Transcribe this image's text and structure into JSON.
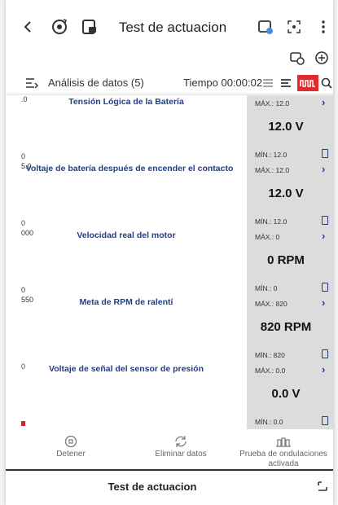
{
  "header": {
    "title": "Test de actuacion",
    "icons": [
      "back-icon",
      "gear-refresh-icon",
      "vehicle-doc-icon",
      "print-icon",
      "screen-capture-icon",
      "more-icon"
    ]
  },
  "subbar": {
    "icons": [
      "car-clock-icon",
      "battery-plug-icon"
    ]
  },
  "toolbar": {
    "label": "Análisis de datos (5)",
    "time": "Tiempo 00:00:02"
  },
  "items": [
    {
      "title": "Tensión Lógica de la Batería",
      "ymax": ".0",
      "ymin": "0",
      "max": "MÁX.: 12.0",
      "min": "MÍN.: 12.0",
      "value": "12.0 V"
    },
    {
      "title": "Voltaje de batería después de encender el contacto",
      "ymax": "5.0",
      "ymin": "0",
      "max": "MÁX.: 12.0",
      "min": "MÍN.: 12.0",
      "value": "12.0 V"
    },
    {
      "title": "Velocidad real del motor",
      "ymax": "000",
      "ymin": "0",
      "max": "MÁX.: 0",
      "min": "MÍN.: 0",
      "value": "0 RPM"
    },
    {
      "title": "Meta de RPM de ralentí",
      "ymax": "550",
      "ymin": "",
      "max": "MÁX.: 820",
      "min": "MÍN.: 820",
      "value": "820 RPM"
    },
    {
      "title": "Voltaje de señal del sensor de presión",
      "ymax": "0",
      "ymin": "",
      "max": "MÁX.: 0.0",
      "min": "MÍN.: 0.0",
      "value": "0.0 V"
    }
  ],
  "bottom": {
    "stop": "Detener",
    "clear": "Eliminar datos",
    "wave": "Prueba de ondulaciones activada"
  },
  "footer": {
    "title": "Test de actuacion"
  },
  "colors": {
    "accent": "#e32b2b",
    "title_blue": "#1f3f8a",
    "side_bg": "#dcdcdc"
  }
}
